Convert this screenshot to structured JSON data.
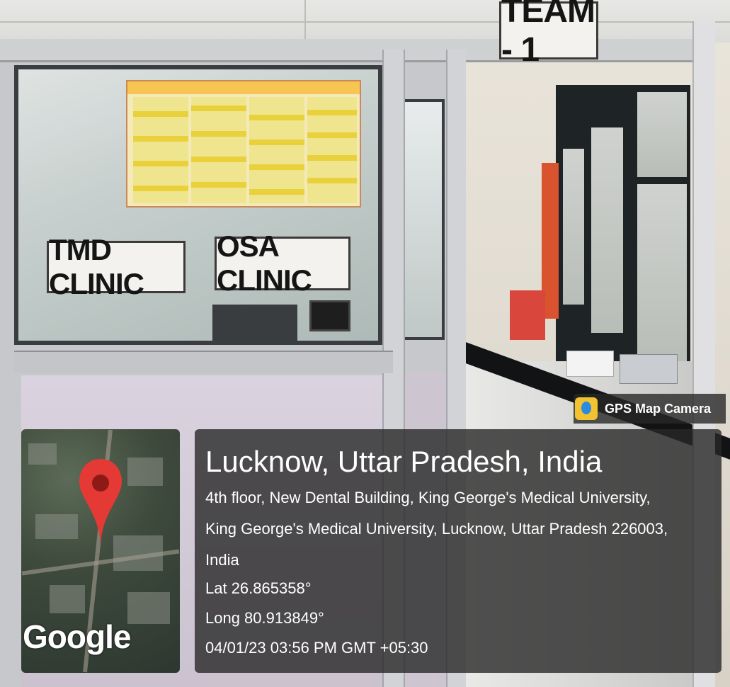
{
  "signs": {
    "team": "TEAM - 1",
    "tmd": "TMD CLINIC",
    "osa": "OSA CLINIC"
  },
  "overlay": {
    "app_name": "GPS Map Camera",
    "map_watermark": "Google",
    "location_title": "Lucknow, Uttar Pradesh, India",
    "address_line1": "4th floor, New Dental Building, King George's Medical University,",
    "address_line2": "King George's Medical University, Lucknow, Uttar Pradesh 226003,",
    "address_line3": "India",
    "latitude": "Lat 26.865358°",
    "longitude": "Long 80.913849°",
    "timestamp": "04/01/23 03:56 PM GMT +05:30"
  },
  "icons": {
    "pin": "map-pin-icon",
    "camera": "gps-map-camera-icon"
  },
  "colors": {
    "pin_red": "#e53935",
    "overlay_bg": "rgba(40,40,40,0.80)"
  }
}
